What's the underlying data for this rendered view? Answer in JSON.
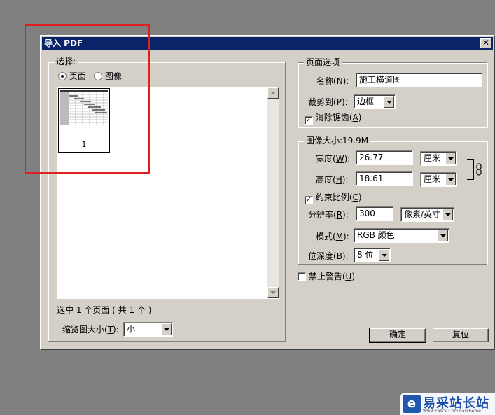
{
  "dialog": {
    "title": "导入 PDF",
    "close_glyph": "✕"
  },
  "select_group": {
    "legend": "选择:",
    "radio_page": "页面",
    "radio_image": "图像",
    "selected": "page",
    "thumbnail_page_number": "1",
    "selection_status_prefix": "选中 ",
    "selection_count": "1",
    "selection_status_mid": " 个页面 ( 共 ",
    "total_count": "1",
    "selection_status_suffix": " 个 )",
    "thumb_size_label": "缩览图大小(",
    "thumb_size_key": "T",
    "thumb_size_label_end": "):",
    "thumb_size_value": "小"
  },
  "page_options": {
    "legend": "页面选项",
    "name_label": "名称(",
    "name_key": "N",
    "name_label_end": "):",
    "name_value": "施工横道图",
    "crop_label": "裁剪到(",
    "crop_key": "P",
    "crop_label_end": "):",
    "crop_value": "边框",
    "antialias_label": "消除锯齿(",
    "antialias_key": "A",
    "antialias_label_end": ")",
    "antialias_checked": true
  },
  "image_size": {
    "legend": "图像大小:19.9M",
    "width_label": "宽度(",
    "width_key": "W",
    "width_label_end": "):",
    "width_value": "26.77",
    "width_unit": "厘米",
    "height_label": "高度(",
    "height_key": "H",
    "height_label_end": "):",
    "height_value": "18.61",
    "height_unit": "厘米",
    "constrain_label": "约束比例(",
    "constrain_key": "C",
    "constrain_label_end": ")",
    "constrain_checked": true,
    "resolution_label": "分辨率(",
    "resolution_key": "R",
    "resolution_label_end": "):",
    "resolution_value": "300",
    "resolution_unit": "像素/英寸",
    "mode_label": "模式(",
    "mode_key": "M",
    "mode_label_end": "):",
    "mode_value": "RGB 颜色",
    "depth_label": "位深度(",
    "depth_key": "B",
    "depth_label_end": "):",
    "depth_value": "8 位"
  },
  "suppress_warnings": {
    "label": "禁止警告(",
    "key": "U",
    "label_end": ")",
    "checked": false
  },
  "buttons": {
    "ok": "确定",
    "reset": "复位"
  },
  "watermark": {
    "mark": "e",
    "title": "易采站长站",
    "subtitle": "Www.Easck.Com Eascheme"
  },
  "colors": {
    "titlebar": "#0a246a",
    "dialog_face": "#d4d0c8",
    "highlight": "#e0201f",
    "desktop": "#808080"
  }
}
